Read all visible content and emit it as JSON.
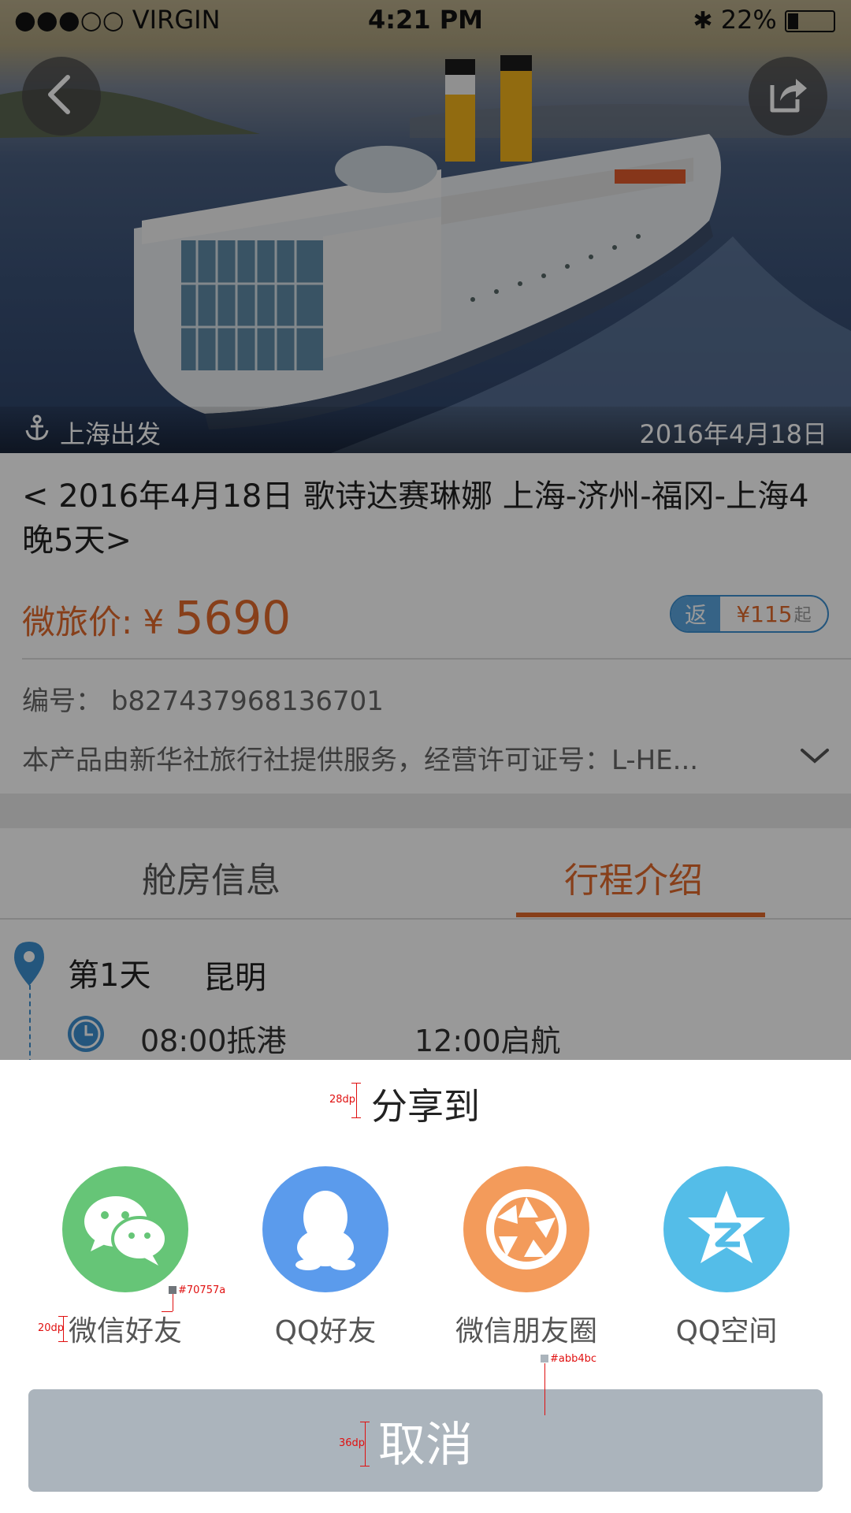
{
  "status_bar": {
    "carrier": "●●●○○ VIRGIN",
    "time": "4:21 PM",
    "battery": "22%"
  },
  "hero": {
    "departure": "上海出发",
    "date": "2016年4月18日",
    "icons": [
      "back-icon",
      "share-icon",
      "anchor-icon"
    ]
  },
  "product": {
    "title": "< 2016年4月18日 歌诗达赛琳娜 上海-济州-福冈-上海4晚5天>",
    "price_label": "微旅价: ¥",
    "price_value": "5690",
    "badge_prefix": "返",
    "badge_value": "¥115",
    "badge_suffix": "起",
    "code_label": "编号：",
    "code_value": "b827437968136701",
    "description": "本产品由新华社旅行社提供服务，经营许可证号：L-HE..."
  },
  "tabs": [
    {
      "label": "舱房信息",
      "active": false
    },
    {
      "label": "行程介绍",
      "active": true
    }
  ],
  "itinerary": {
    "day": "第1天",
    "city": "昆明",
    "arrive": "08:00抵港",
    "depart": "12:00启航"
  },
  "share_sheet": {
    "title": "分享到",
    "items": [
      {
        "label": "微信好友",
        "icon": "wechat-icon",
        "color": "#66c577"
      },
      {
        "label": "QQ好友",
        "icon": "qq-icon",
        "color": "#5b9bec"
      },
      {
        "label": "微信朋友圈",
        "icon": "moments-icon",
        "color": "#f39b5b"
      },
      {
        "label": "QQ空间",
        "icon": "qzone-icon",
        "color": "#54bde8"
      }
    ],
    "cancel": "取消"
  },
  "annotations": {
    "title_size": "28dp",
    "label_size": "20dp",
    "label_color": "#70757a",
    "button_color": "#abb4bc",
    "button_text_size": "36dp"
  },
  "colors": {
    "accent_orange": "#e26a2c",
    "accent_blue": "#3d8fd0",
    "cancel_bg": "#abb4bc"
  }
}
